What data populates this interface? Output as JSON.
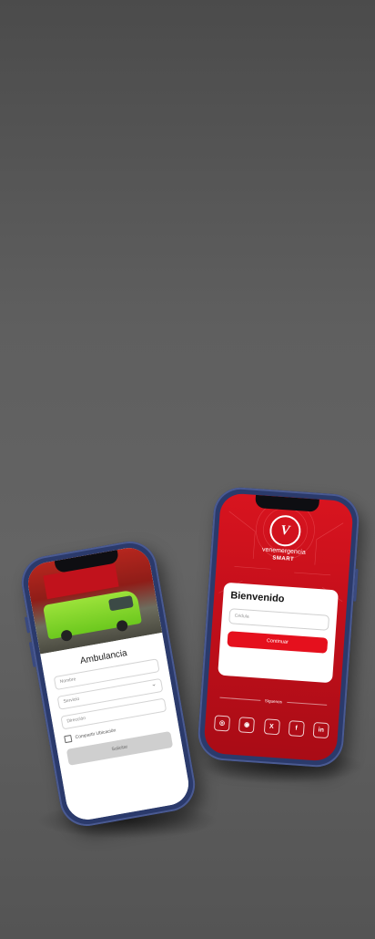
{
  "ambulance_screen": {
    "sign_text": "",
    "title": "Ambulancia",
    "description": "",
    "fields": [
      {
        "placeholder": "Nombre"
      },
      {
        "placeholder": "Servicio"
      },
      {
        "placeholder": "Dirección"
      }
    ],
    "note": "",
    "checkbox_label": "Compartir Ubicación",
    "submit_label": "Solicitar"
  },
  "login_screen": {
    "brand_name": "venemergencia",
    "brand_sub": "SMART",
    "title": "Bienvenido",
    "description": "",
    "input_placeholder": "Cédula",
    "continue_label": "Continuar",
    "divider_text": "Síguenos",
    "social": [
      {
        "icon": "whatsapp-icon",
        "glyph": "◎"
      },
      {
        "icon": "instagram-icon",
        "glyph": "◉"
      },
      {
        "icon": "x-icon",
        "glyph": "X"
      },
      {
        "icon": "facebook-icon",
        "glyph": "f"
      },
      {
        "icon": "linkedin-icon",
        "glyph": "in"
      }
    ],
    "accent_color": "#d8141f"
  }
}
